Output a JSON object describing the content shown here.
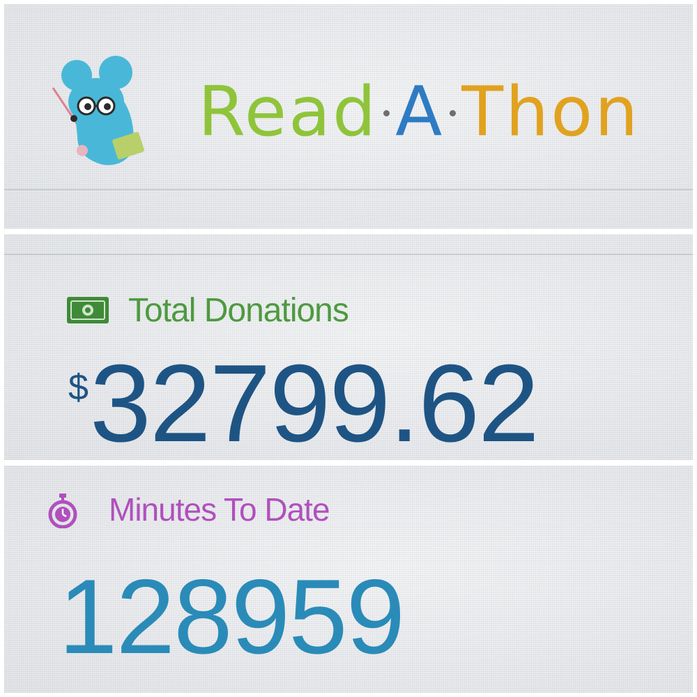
{
  "header": {
    "brand": {
      "part1": "Read",
      "part2": "A",
      "part3": "Thon"
    },
    "mascot": "mouse-reading-icon"
  },
  "donations": {
    "icon": "money-icon",
    "label": "Total Donations",
    "currency": "$",
    "amount": "32799.62"
  },
  "minutes": {
    "icon": "stopwatch-icon",
    "label": "Minutes To Date",
    "value": "128959"
  },
  "colors": {
    "donations_label": "#4d9a3f",
    "donations_amount": "#1e5484",
    "minutes_label": "#b050bd",
    "minutes_value": "#2a8bb8",
    "brand_r": "#8fc43a",
    "brand_a": "#2e7bc4",
    "brand_t": "#e0a21f"
  }
}
